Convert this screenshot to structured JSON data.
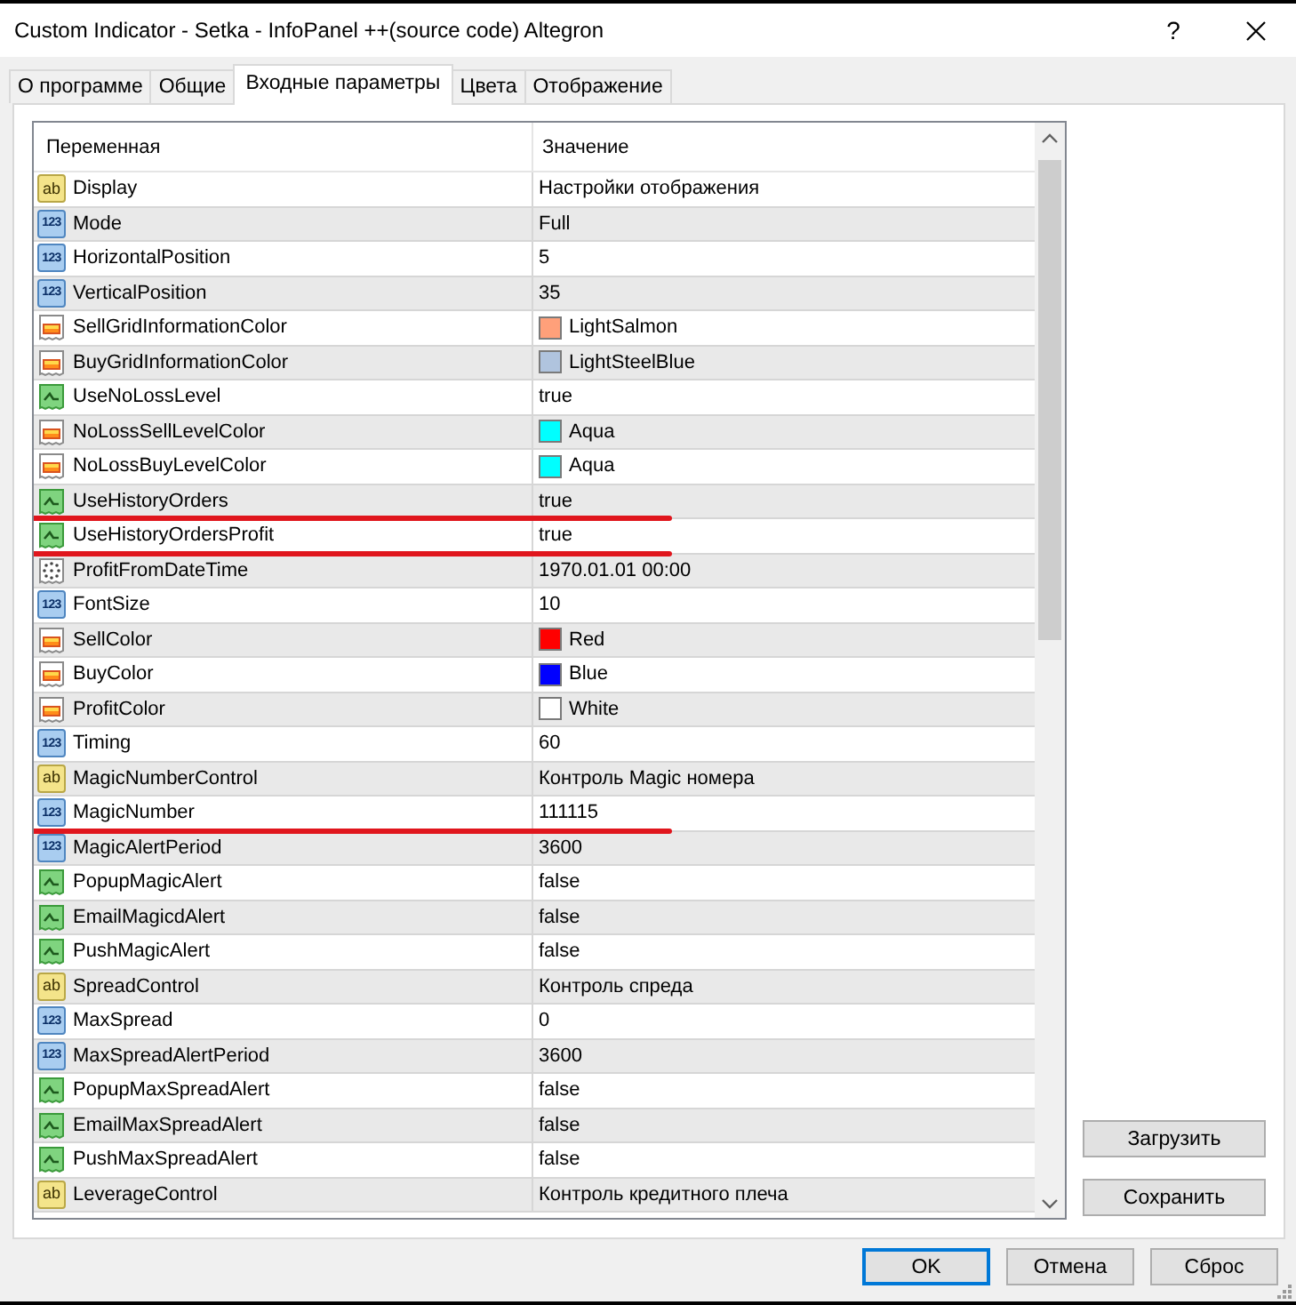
{
  "window": {
    "title": "Custom Indicator - Setka - InfoPanel ++(source code) Altegron",
    "help_button": "?"
  },
  "tabs": [
    {
      "label": "О программе",
      "selected": false
    },
    {
      "label": "Общие",
      "selected": false
    },
    {
      "label": "Входные параметры",
      "selected": true
    },
    {
      "label": "Цвета",
      "selected": false
    },
    {
      "label": "Отображение",
      "selected": false
    }
  ],
  "table": {
    "columns": [
      "Переменная",
      "Значение"
    ],
    "rows": [
      {
        "kind": "string",
        "badge": "ab",
        "name": "Display",
        "value": "Настройки отображения",
        "underlined": false
      },
      {
        "kind": "int",
        "badge": "123",
        "name": "Mode",
        "value": "Full",
        "underlined": false
      },
      {
        "kind": "int",
        "badge": "123",
        "name": "HorizontalPosition",
        "value": "5",
        "underlined": false
      },
      {
        "kind": "int",
        "badge": "123",
        "name": "VerticalPosition",
        "value": "35",
        "underlined": false
      },
      {
        "kind": "color",
        "name": "SellGridInformationColor",
        "value": "LightSalmon",
        "color": "#ffa07a",
        "underlined": false
      },
      {
        "kind": "color",
        "name": "BuyGridInformationColor",
        "value": "LightSteelBlue",
        "color": "#b0c4de",
        "underlined": false
      },
      {
        "kind": "bool",
        "name": "UseNoLossLevel",
        "value": "true",
        "underlined": false
      },
      {
        "kind": "color",
        "name": "NoLossSellLevelColor",
        "value": "Aqua",
        "color": "#00ffff",
        "underlined": false
      },
      {
        "kind": "color",
        "name": "NoLossBuyLevelColor",
        "value": "Aqua",
        "color": "#00ffff",
        "underlined": false
      },
      {
        "kind": "bool",
        "name": "UseHistoryOrders",
        "value": "true",
        "underlined": true
      },
      {
        "kind": "bool",
        "name": "UseHistoryOrdersProfit",
        "value": "true",
        "underlined": true
      },
      {
        "kind": "datetime",
        "name": "ProfitFromDateTime",
        "value": "1970.01.01 00:00",
        "underlined": false
      },
      {
        "kind": "int",
        "badge": "123",
        "name": "FontSize",
        "value": "10",
        "underlined": false
      },
      {
        "kind": "color",
        "name": "SellColor",
        "value": "Red",
        "color": "#ff0000",
        "underlined": false
      },
      {
        "kind": "color",
        "name": "BuyColor",
        "value": "Blue",
        "color": "#0000ff",
        "underlined": false
      },
      {
        "kind": "color",
        "name": "ProfitColor",
        "value": "White",
        "color": "#ffffff",
        "underlined": false
      },
      {
        "kind": "int",
        "badge": "123",
        "name": "Timing",
        "value": "60",
        "underlined": false
      },
      {
        "kind": "string",
        "badge": "ab",
        "name": "MagicNumberControl",
        "value": "Контроль Magic номера",
        "underlined": false
      },
      {
        "kind": "int",
        "badge": "123",
        "name": "MagicNumber",
        "value": "111115",
        "underlined": true
      },
      {
        "kind": "int",
        "badge": "123",
        "name": "MagicAlertPeriod",
        "value": "3600",
        "underlined": false
      },
      {
        "kind": "bool",
        "name": "PopupMagicAlert",
        "value": "false",
        "underlined": false
      },
      {
        "kind": "bool",
        "name": "EmailMagicdAlert",
        "value": "false",
        "underlined": false
      },
      {
        "kind": "bool",
        "name": "PushMagicAlert",
        "value": "false",
        "underlined": false
      },
      {
        "kind": "string",
        "badge": "ab",
        "name": "SpreadControl",
        "value": "Контроль спреда",
        "underlined": false
      },
      {
        "kind": "int",
        "badge": "123",
        "name": "MaxSpread",
        "value": "0",
        "underlined": false
      },
      {
        "kind": "int",
        "badge": "123",
        "name": "MaxSpreadAlertPeriod",
        "value": "3600",
        "underlined": false
      },
      {
        "kind": "bool",
        "name": "PopupMaxSpreadAlert",
        "value": "false",
        "underlined": false
      },
      {
        "kind": "bool",
        "name": "EmailMaxSpreadAlert",
        "value": "false",
        "underlined": false
      },
      {
        "kind": "bool",
        "name": "PushMaxSpreadAlert",
        "value": "false",
        "underlined": false
      },
      {
        "kind": "string",
        "badge": "ab",
        "name": "LeverageControl",
        "value": "Контроль кредитного плеча",
        "underlined": false
      }
    ]
  },
  "side_buttons": [
    "Загрузить",
    "Сохранить"
  ],
  "buttons": [
    {
      "label": "OK",
      "default": true
    },
    {
      "label": "Отмена",
      "default": false
    },
    {
      "label": "Сброс",
      "default": false
    }
  ]
}
